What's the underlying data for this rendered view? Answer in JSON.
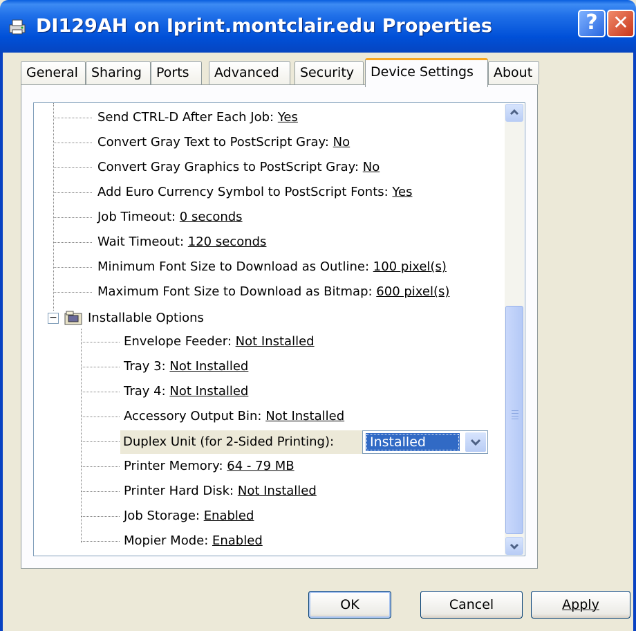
{
  "window": {
    "title": "DI129AH on Iprint.montclair.edu Properties",
    "help_glyph": "?",
    "close_glyph": "✕"
  },
  "tabs": [
    {
      "label": "General"
    },
    {
      "label": "Sharing"
    },
    {
      "label": "Ports"
    },
    {
      "label": "Advanced"
    },
    {
      "label": "Security"
    },
    {
      "label": "Device Settings",
      "active": true
    },
    {
      "label": "About"
    }
  ],
  "tree": {
    "items": [
      {
        "label": "Send CTRL-D After Each Job: ",
        "value": "Yes"
      },
      {
        "label": "Convert Gray Text to PostScript Gray: ",
        "value": "No"
      },
      {
        "label": "Convert Gray Graphics to PostScript Gray: ",
        "value": "No"
      },
      {
        "label": "Add Euro Currency Symbol to PostScript Fonts: ",
        "value": "Yes"
      },
      {
        "label": "Job Timeout: ",
        "value": "0 seconds"
      },
      {
        "label": "Wait Timeout: ",
        "value": "120 seconds"
      },
      {
        "label": "Minimum Font Size to Download as Outline: ",
        "value": "100 pixel(s)"
      },
      {
        "label": "Maximum Font Size to Download as Bitmap: ",
        "value": "600 pixel(s)"
      }
    ],
    "group_label": "Installable Options",
    "group_expander": "−",
    "options": [
      {
        "label": "Envelope Feeder: ",
        "value": "Not Installed"
      },
      {
        "label": "Tray 3: ",
        "value": "Not Installed"
      },
      {
        "label": "Tray 4: ",
        "value": "Not Installed"
      },
      {
        "label": "Accessory Output Bin: ",
        "value": "Not Installed"
      },
      {
        "label": "Duplex Unit (for 2-Sided Printing):",
        "value": "Installed"
      },
      {
        "label": "Printer Memory: ",
        "value": "64 - 79 MB"
      },
      {
        "label": "Printer Hard Disk: ",
        "value": "Not Installed"
      },
      {
        "label": "Job Storage: ",
        "value": "Enabled"
      },
      {
        "label": "Mopier Mode: ",
        "value": "Enabled"
      }
    ]
  },
  "buttons": {
    "ok": "OK",
    "cancel": "Cancel",
    "apply": "Apply"
  }
}
